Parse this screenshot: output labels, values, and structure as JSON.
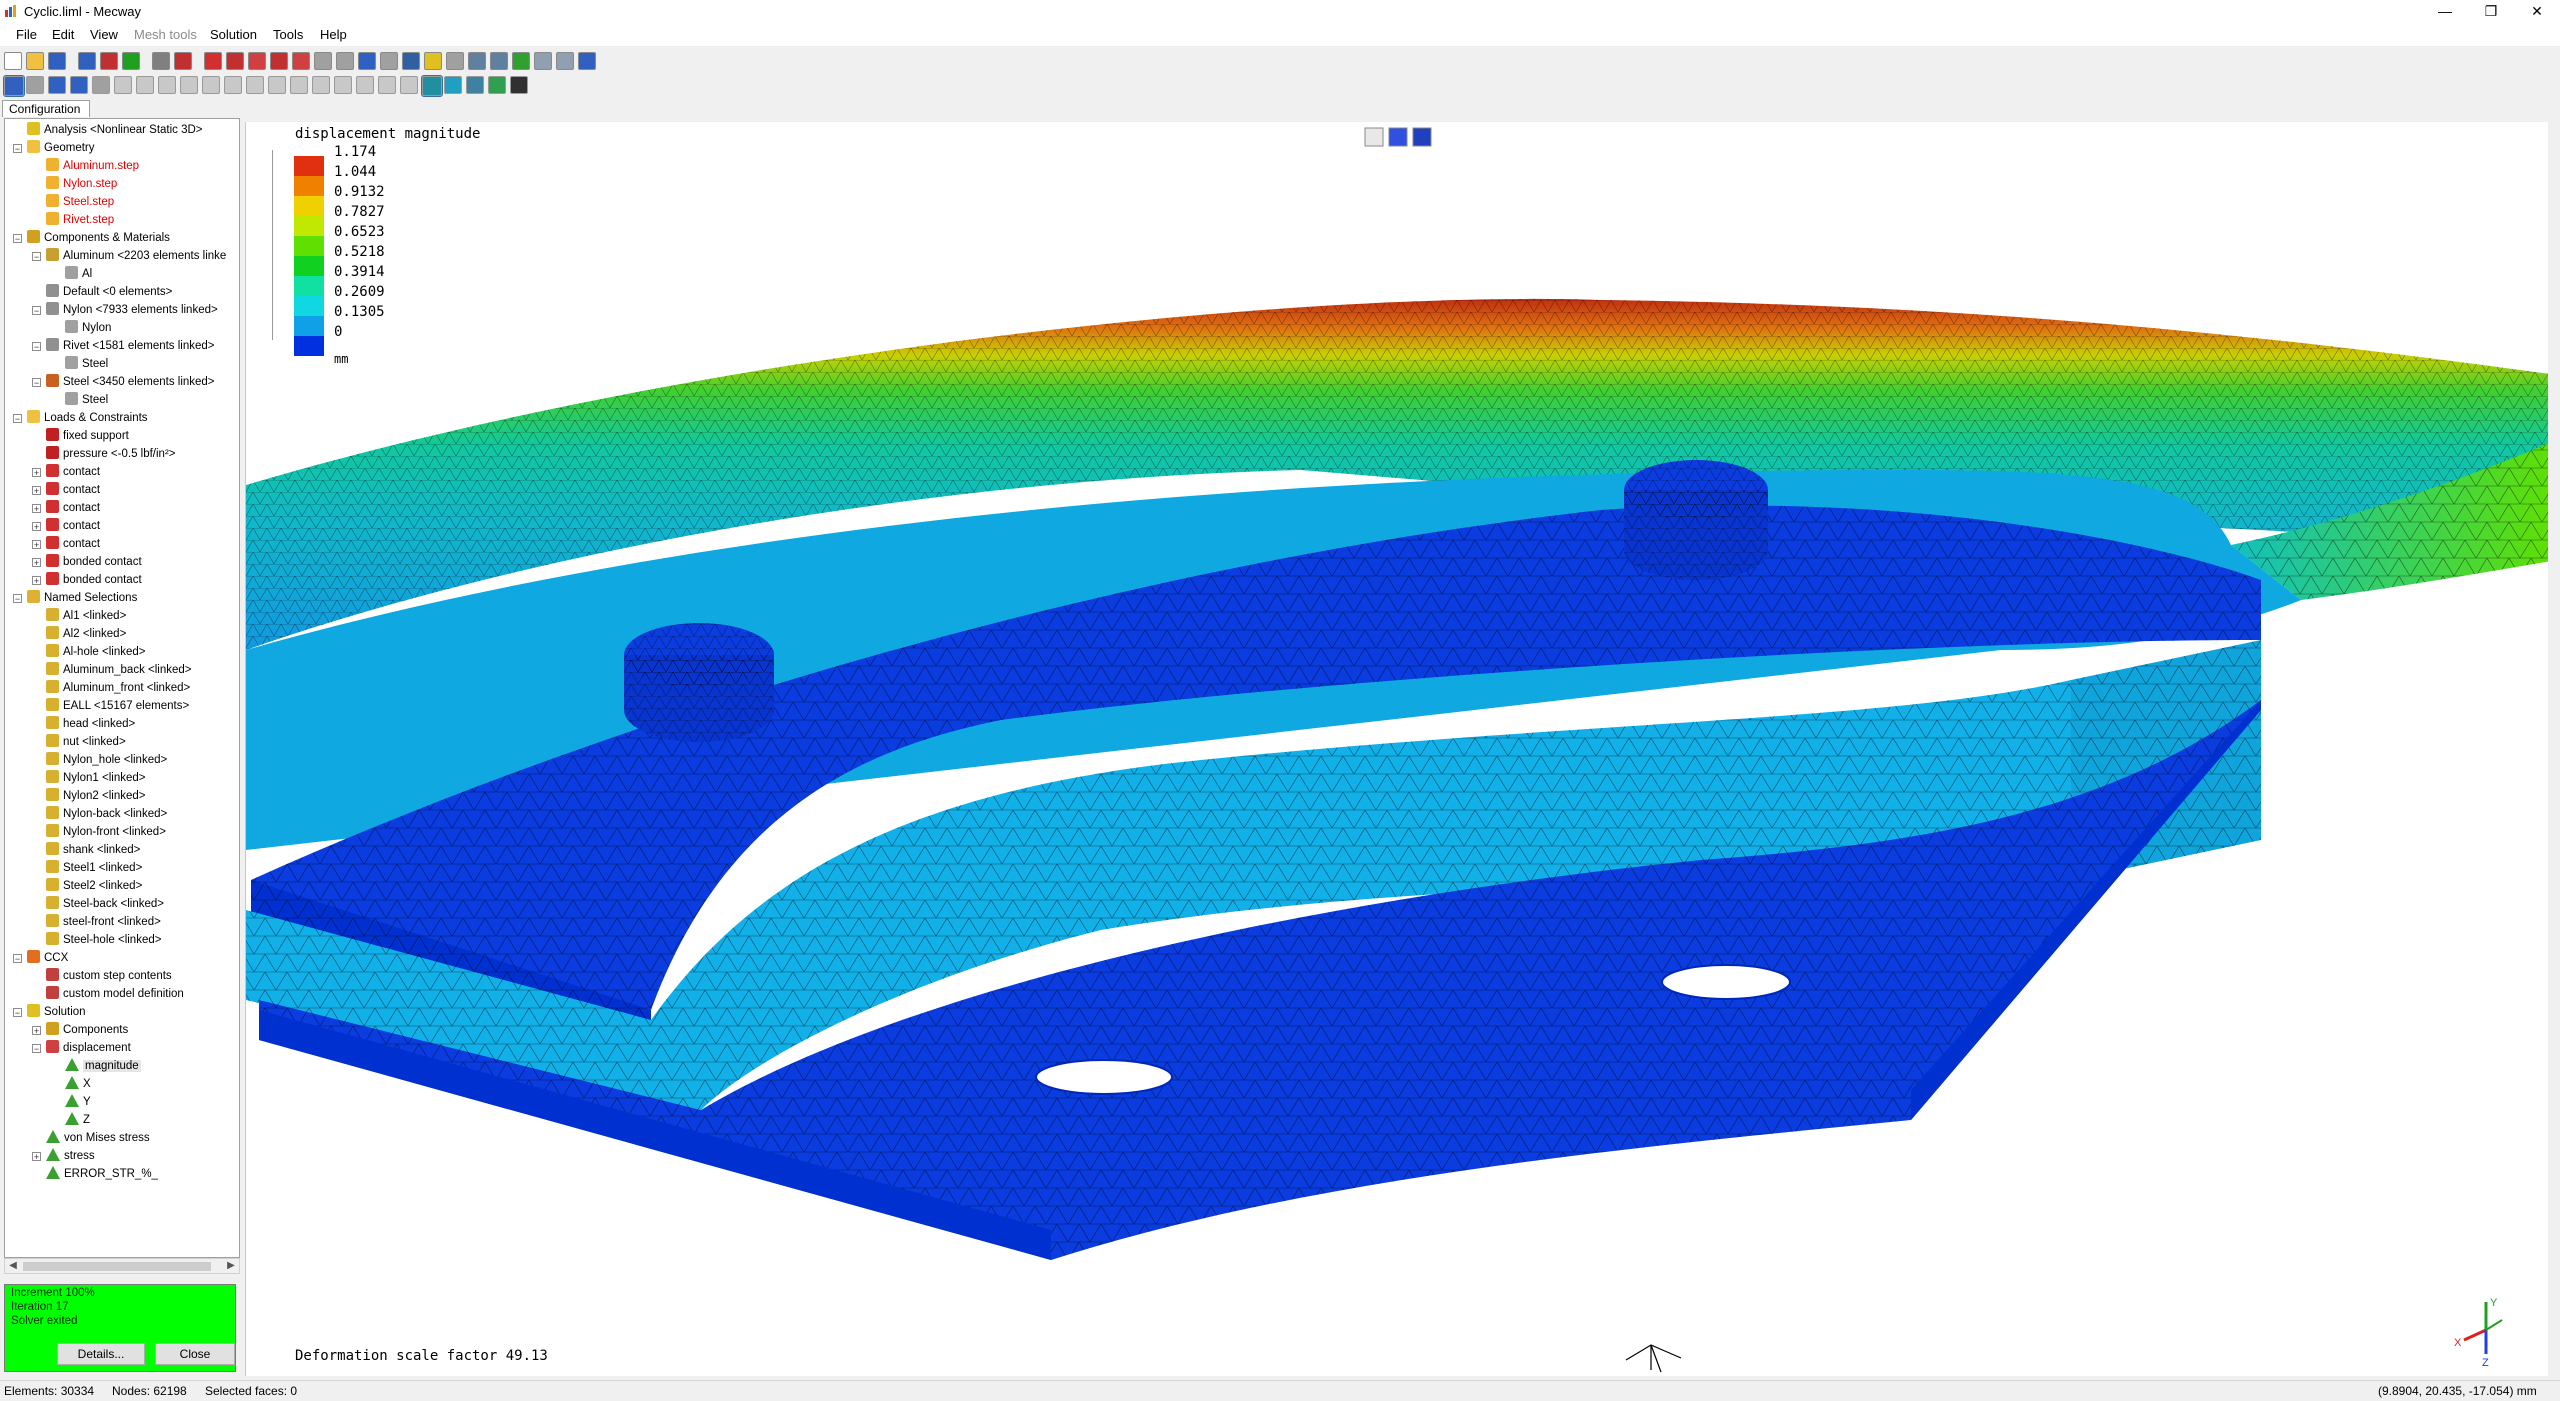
{
  "window": {
    "title": "Cyclic.liml - Mecway",
    "minimize": "—",
    "restore": "❐",
    "close": "✕"
  },
  "menu": {
    "items": [
      "File",
      "Edit",
      "View",
      "Mesh tools",
      "Solution",
      "Tools",
      "Help"
    ],
    "disabled": [
      "Mesh tools"
    ]
  },
  "panel": {
    "tab": "Configuration",
    "tree": [
      {
        "label": "Analysis <Nonlinear Static 3D>",
        "level": 0,
        "icon": "analysis-icon",
        "color": "#e0c020"
      },
      {
        "label": "Geometry",
        "level": 0,
        "icon": "folder-icon",
        "color": "#f0c040",
        "exp": "-"
      },
      {
        "label": "Aluminum.step",
        "level": 1,
        "icon": "step-file-icon",
        "color": "#f0b030",
        "red": true
      },
      {
        "label": "Nylon.step",
        "level": 1,
        "icon": "step-file-icon",
        "color": "#f0b030",
        "red": true
      },
      {
        "label": "Steel.step",
        "level": 1,
        "icon": "step-file-icon",
        "color": "#f0b030",
        "red": true
      },
      {
        "label": "Rivet.step",
        "level": 1,
        "icon": "step-file-icon",
        "color": "#f0b030",
        "red": true
      },
      {
        "label": "Components & Materials",
        "level": 0,
        "icon": "components-icon",
        "color": "#d0a020",
        "exp": "-"
      },
      {
        "label": "Aluminum <2203 elements linke",
        "level": 1,
        "icon": "component-icon",
        "color": "#c8a030",
        "exp": "-"
      },
      {
        "label": "Al",
        "level": 2,
        "icon": "material-icon",
        "color": "#a0a0a0"
      },
      {
        "label": "Default <0 elements>",
        "level": 1,
        "icon": "component-icon",
        "color": "#909090"
      },
      {
        "label": "Nylon <7933 elements linked>",
        "level": 1,
        "icon": "component-icon",
        "color": "#909090",
        "exp": "-"
      },
      {
        "label": "Nylon",
        "level": 2,
        "icon": "material-icon",
        "color": "#a0a0a0"
      },
      {
        "label": "Rivet <1581 elements linked>",
        "level": 1,
        "icon": "component-icon",
        "color": "#909090",
        "exp": "-"
      },
      {
        "label": "Steel",
        "level": 2,
        "icon": "material-icon",
        "color": "#a0a0a0"
      },
      {
        "label": "Steel <3450 elements linked>",
        "level": 1,
        "icon": "component-icon",
        "color": "#c86020",
        "exp": "-"
      },
      {
        "label": "Steel",
        "level": 2,
        "icon": "material-icon",
        "color": "#a0a0a0"
      },
      {
        "label": "Loads & Constraints",
        "level": 0,
        "icon": "loads-folder-icon",
        "color": "#f0c040",
        "exp": "-"
      },
      {
        "label": "fixed support",
        "level": 1,
        "icon": "fixed-support-icon",
        "color": "#c02020"
      },
      {
        "label": "pressure <-0.5 lbf/in²>",
        "level": 1,
        "icon": "pressure-icon",
        "color": "#c02020"
      },
      {
        "label": "contact",
        "level": 1,
        "icon": "contact-icon",
        "color": "#d03030",
        "exp": "+"
      },
      {
        "label": "contact",
        "level": 1,
        "icon": "contact-icon",
        "color": "#d03030",
        "exp": "+"
      },
      {
        "label": "contact",
        "level": 1,
        "icon": "contact-icon",
        "color": "#d03030",
        "exp": "+"
      },
      {
        "label": "contact",
        "level": 1,
        "icon": "contact-icon",
        "color": "#d03030",
        "exp": "+"
      },
      {
        "label": "contact",
        "level": 1,
        "icon": "contact-icon",
        "color": "#d03030",
        "exp": "+"
      },
      {
        "label": "bonded contact",
        "level": 1,
        "icon": "bonded-contact-icon",
        "color": "#d03030",
        "exp": "+"
      },
      {
        "label": "bonded contact",
        "level": 1,
        "icon": "bonded-contact-icon",
        "color": "#d03030",
        "exp": "+"
      },
      {
        "label": "Named Selections",
        "level": 0,
        "icon": "named-selections-icon",
        "color": "#e0b030",
        "exp": "-"
      },
      {
        "label": "Al1 <linked>",
        "level": 1,
        "icon": "selection-icon",
        "color": "#d8b030"
      },
      {
        "label": "Al2 <linked>",
        "level": 1,
        "icon": "selection-icon",
        "color": "#d8b030"
      },
      {
        "label": "Al-hole <linked>",
        "level": 1,
        "icon": "selection-icon",
        "color": "#d8b030"
      },
      {
        "label": "Aluminum_back <linked>",
        "level": 1,
        "icon": "selection-icon",
        "color": "#d8b030"
      },
      {
        "label": "Aluminum_front <linked>",
        "level": 1,
        "icon": "selection-icon",
        "color": "#d8b030"
      },
      {
        "label": "EALL <15167 elements>",
        "level": 1,
        "icon": "selection-icon",
        "color": "#d8b030"
      },
      {
        "label": "head <linked>",
        "level": 1,
        "icon": "selection-icon",
        "color": "#d8b030"
      },
      {
        "label": "nut <linked>",
        "level": 1,
        "icon": "selection-icon",
        "color": "#d8b030"
      },
      {
        "label": "Nylon_hole <linked>",
        "level": 1,
        "icon": "selection-icon",
        "color": "#d8b030"
      },
      {
        "label": "Nylon1 <linked>",
        "level": 1,
        "icon": "selection-icon",
        "color": "#d8b030"
      },
      {
        "label": "Nylon2 <linked>",
        "level": 1,
        "icon": "selection-icon",
        "color": "#d8b030"
      },
      {
        "label": "Nylon-back <linked>",
        "level": 1,
        "icon": "selection-icon",
        "color": "#d8b030"
      },
      {
        "label": "Nylon-front <linked>",
        "level": 1,
        "icon": "selection-icon",
        "color": "#d8b030"
      },
      {
        "label": "shank <linked>",
        "level": 1,
        "icon": "selection-icon",
        "color": "#d8b030"
      },
      {
        "label": "Steel1 <linked>",
        "level": 1,
        "icon": "selection-icon",
        "color": "#d8b030"
      },
      {
        "label": "Steel2 <linked>",
        "level": 1,
        "icon": "selection-icon",
        "color": "#d8b030"
      },
      {
        "label": "Steel-back <linked>",
        "level": 1,
        "icon": "selection-icon",
        "color": "#d8b030"
      },
      {
        "label": "steel-front <linked>",
        "level": 1,
        "icon": "selection-icon",
        "color": "#d8b030"
      },
      {
        "label": "Steel-hole <linked>",
        "level": 1,
        "icon": "selection-icon",
        "color": "#d8b030"
      },
      {
        "label": "CCX",
        "level": 0,
        "icon": "ccx-icon",
        "color": "#e07020",
        "exp": "-"
      },
      {
        "label": "custom step contents",
        "level": 1,
        "icon": "ccx-file-icon",
        "color": "#c04040"
      },
      {
        "label": "custom model definition",
        "level": 1,
        "icon": "ccx-file-icon",
        "color": "#c04040"
      },
      {
        "label": "Solution",
        "level": 0,
        "icon": "solution-icon",
        "color": "#e0c020",
        "exp": "-"
      },
      {
        "label": "Components",
        "level": 1,
        "icon": "components-icon",
        "color": "#d0a020",
        "exp": "+"
      },
      {
        "label": "displacement",
        "level": 1,
        "icon": "displacement-icon",
        "color": "#d04040",
        "exp": "-"
      },
      {
        "label": "magnitude",
        "level": 2,
        "icon": "result-triangle-icon",
        "color": "#40a040",
        "hl": true
      },
      {
        "label": "X",
        "level": 2,
        "icon": "result-triangle-icon",
        "color": "#40a040"
      },
      {
        "label": "Y",
        "level": 2,
        "icon": "result-triangle-icon",
        "color": "#40a040"
      },
      {
        "label": "Z",
        "level": 2,
        "icon": "result-triangle-icon",
        "color": "#40a040"
      },
      {
        "label": "von Mises stress",
        "level": 1,
        "icon": "result-triangle-icon",
        "color": "#40a040"
      },
      {
        "label": "stress",
        "level": 1,
        "icon": "result-triangle-icon",
        "color": "#40a040",
        "exp": "+"
      },
      {
        "label": "ERROR_STR_%_",
        "level": 1,
        "icon": "result-triangle-icon",
        "color": "#40a040"
      }
    ]
  },
  "solver": {
    "lines": [
      "Increment 100%",
      "Iteration 17",
      "Solver exited"
    ],
    "details": "Details...",
    "close": "Close",
    "color": "#00ff00"
  },
  "legend": {
    "title": "displacement magnitude",
    "unit": "mm",
    "labels": [
      "1.174",
      "1.044",
      "0.9132",
      "0.7827",
      "0.6523",
      "0.5218",
      "0.3914",
      "0.2609",
      "0.1305",
      "0"
    ],
    "colors": [
      "#e03010",
      "#f08000",
      "#f0d000",
      "#c0e800",
      "#60e000",
      "#10d020",
      "#10e0a0",
      "#10d8e0",
      "#10a0e8",
      "#0030e0"
    ]
  },
  "viewport": {
    "deformation": "Deformation scale factor 49.13"
  },
  "statusbar": {
    "elements": "Elements: 30334",
    "nodes": "Nodes: 62198",
    "selected": "Selected faces: 0",
    "coords": "(9.8904, 20.435, -17.054) mm"
  },
  "axes": {
    "x": "X",
    "y": "Y",
    "z": "Z"
  }
}
